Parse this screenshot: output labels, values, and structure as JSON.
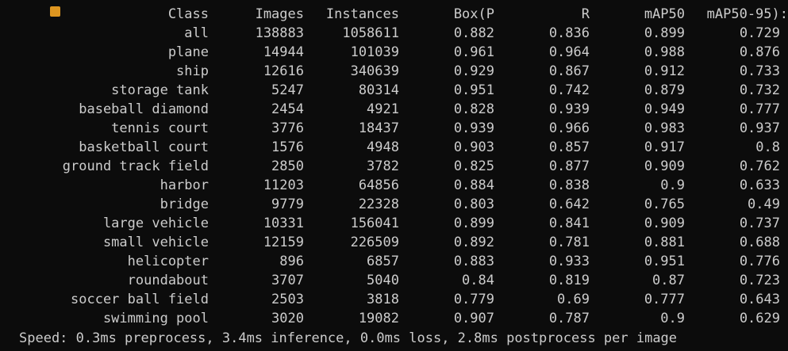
{
  "header": {
    "class": "Class",
    "images": "Images",
    "instances": "Instances",
    "box_p": "Box(P",
    "r": "R",
    "map50": "mAP50",
    "map50_95": "mAP50-95):"
  },
  "rows": [
    {
      "class": "all",
      "images": "138883",
      "instances": "1058611",
      "box_p": "0.882",
      "r": "0.836",
      "map50": "0.899",
      "map50_95": "0.729"
    },
    {
      "class": "plane",
      "images": "14944",
      "instances": "101039",
      "box_p": "0.961",
      "r": "0.964",
      "map50": "0.988",
      "map50_95": "0.876"
    },
    {
      "class": "ship",
      "images": "12616",
      "instances": "340639",
      "box_p": "0.929",
      "r": "0.867",
      "map50": "0.912",
      "map50_95": "0.733"
    },
    {
      "class": "storage tank",
      "images": "5247",
      "instances": "80314",
      "box_p": "0.951",
      "r": "0.742",
      "map50": "0.879",
      "map50_95": "0.732"
    },
    {
      "class": "baseball diamond",
      "images": "2454",
      "instances": "4921",
      "box_p": "0.828",
      "r": "0.939",
      "map50": "0.949",
      "map50_95": "0.777"
    },
    {
      "class": "tennis court",
      "images": "3776",
      "instances": "18437",
      "box_p": "0.939",
      "r": "0.966",
      "map50": "0.983",
      "map50_95": "0.937"
    },
    {
      "class": "basketball court",
      "images": "1576",
      "instances": "4948",
      "box_p": "0.903",
      "r": "0.857",
      "map50": "0.917",
      "map50_95": "0.8"
    },
    {
      "class": "ground track field",
      "images": "2850",
      "instances": "3782",
      "box_p": "0.825",
      "r": "0.877",
      "map50": "0.909",
      "map50_95": "0.762"
    },
    {
      "class": "harbor",
      "images": "11203",
      "instances": "64856",
      "box_p": "0.884",
      "r": "0.838",
      "map50": "0.9",
      "map50_95": "0.633"
    },
    {
      "class": "bridge",
      "images": "9779",
      "instances": "22328",
      "box_p": "0.803",
      "r": "0.642",
      "map50": "0.765",
      "map50_95": "0.49"
    },
    {
      "class": "large vehicle",
      "images": "10331",
      "instances": "156041",
      "box_p": "0.899",
      "r": "0.841",
      "map50": "0.909",
      "map50_95": "0.737"
    },
    {
      "class": "small vehicle",
      "images": "12159",
      "instances": "226509",
      "box_p": "0.892",
      "r": "0.781",
      "map50": "0.881",
      "map50_95": "0.688"
    },
    {
      "class": "helicopter",
      "images": "896",
      "instances": "6857",
      "box_p": "0.883",
      "r": "0.933",
      "map50": "0.951",
      "map50_95": "0.776"
    },
    {
      "class": "roundabout",
      "images": "3707",
      "instances": "5040",
      "box_p": "0.84",
      "r": "0.819",
      "map50": "0.87",
      "map50_95": "0.723"
    },
    {
      "class": "soccer ball field",
      "images": "2503",
      "instances": "3818",
      "box_p": "0.779",
      "r": "0.69",
      "map50": "0.777",
      "map50_95": "0.643"
    },
    {
      "class": "swimming pool",
      "images": "3020",
      "instances": "19082",
      "box_p": "0.907",
      "r": "0.787",
      "map50": "0.9",
      "map50_95": "0.629"
    }
  ],
  "footer": "Speed: 0.3ms preprocess, 3.4ms inference, 0.0ms loss, 2.8ms postprocess per image",
  "colors": {
    "background": "#0c0c0c",
    "text": "#cccccc",
    "warning_icon": "#f5a623"
  },
  "icons": {
    "cut_line_icon": "warning-icon"
  }
}
